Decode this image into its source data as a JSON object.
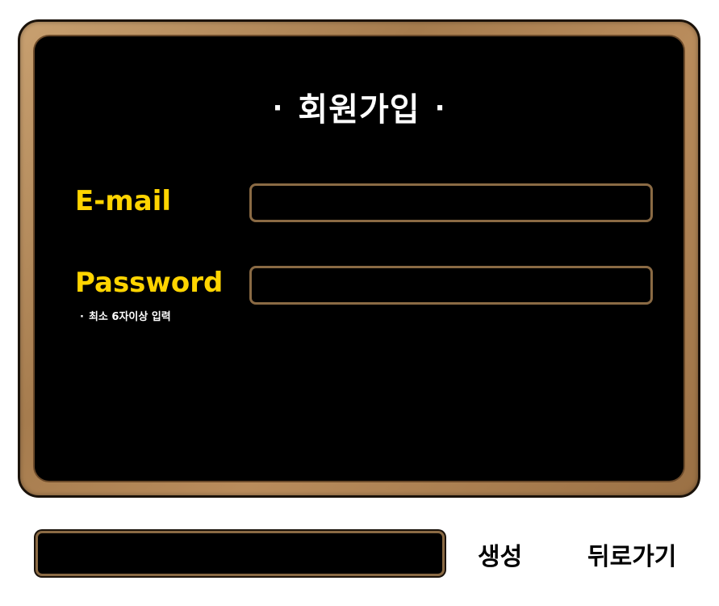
{
  "form": {
    "title": "회원가입",
    "title_dot_left": "·",
    "title_dot_right": "·",
    "email_label": "E-mail",
    "email_value": "",
    "password_label": "Password",
    "password_value": "",
    "password_hint_bullet": "·",
    "password_hint": "최소 6자이상 입력"
  },
  "footer": {
    "status_text": "",
    "create_label": "생성",
    "back_label": "뒤로가기"
  },
  "colors": {
    "label_yellow": "#ffd400",
    "board_black": "#000000",
    "frame_wood": "#a67c4e"
  }
}
